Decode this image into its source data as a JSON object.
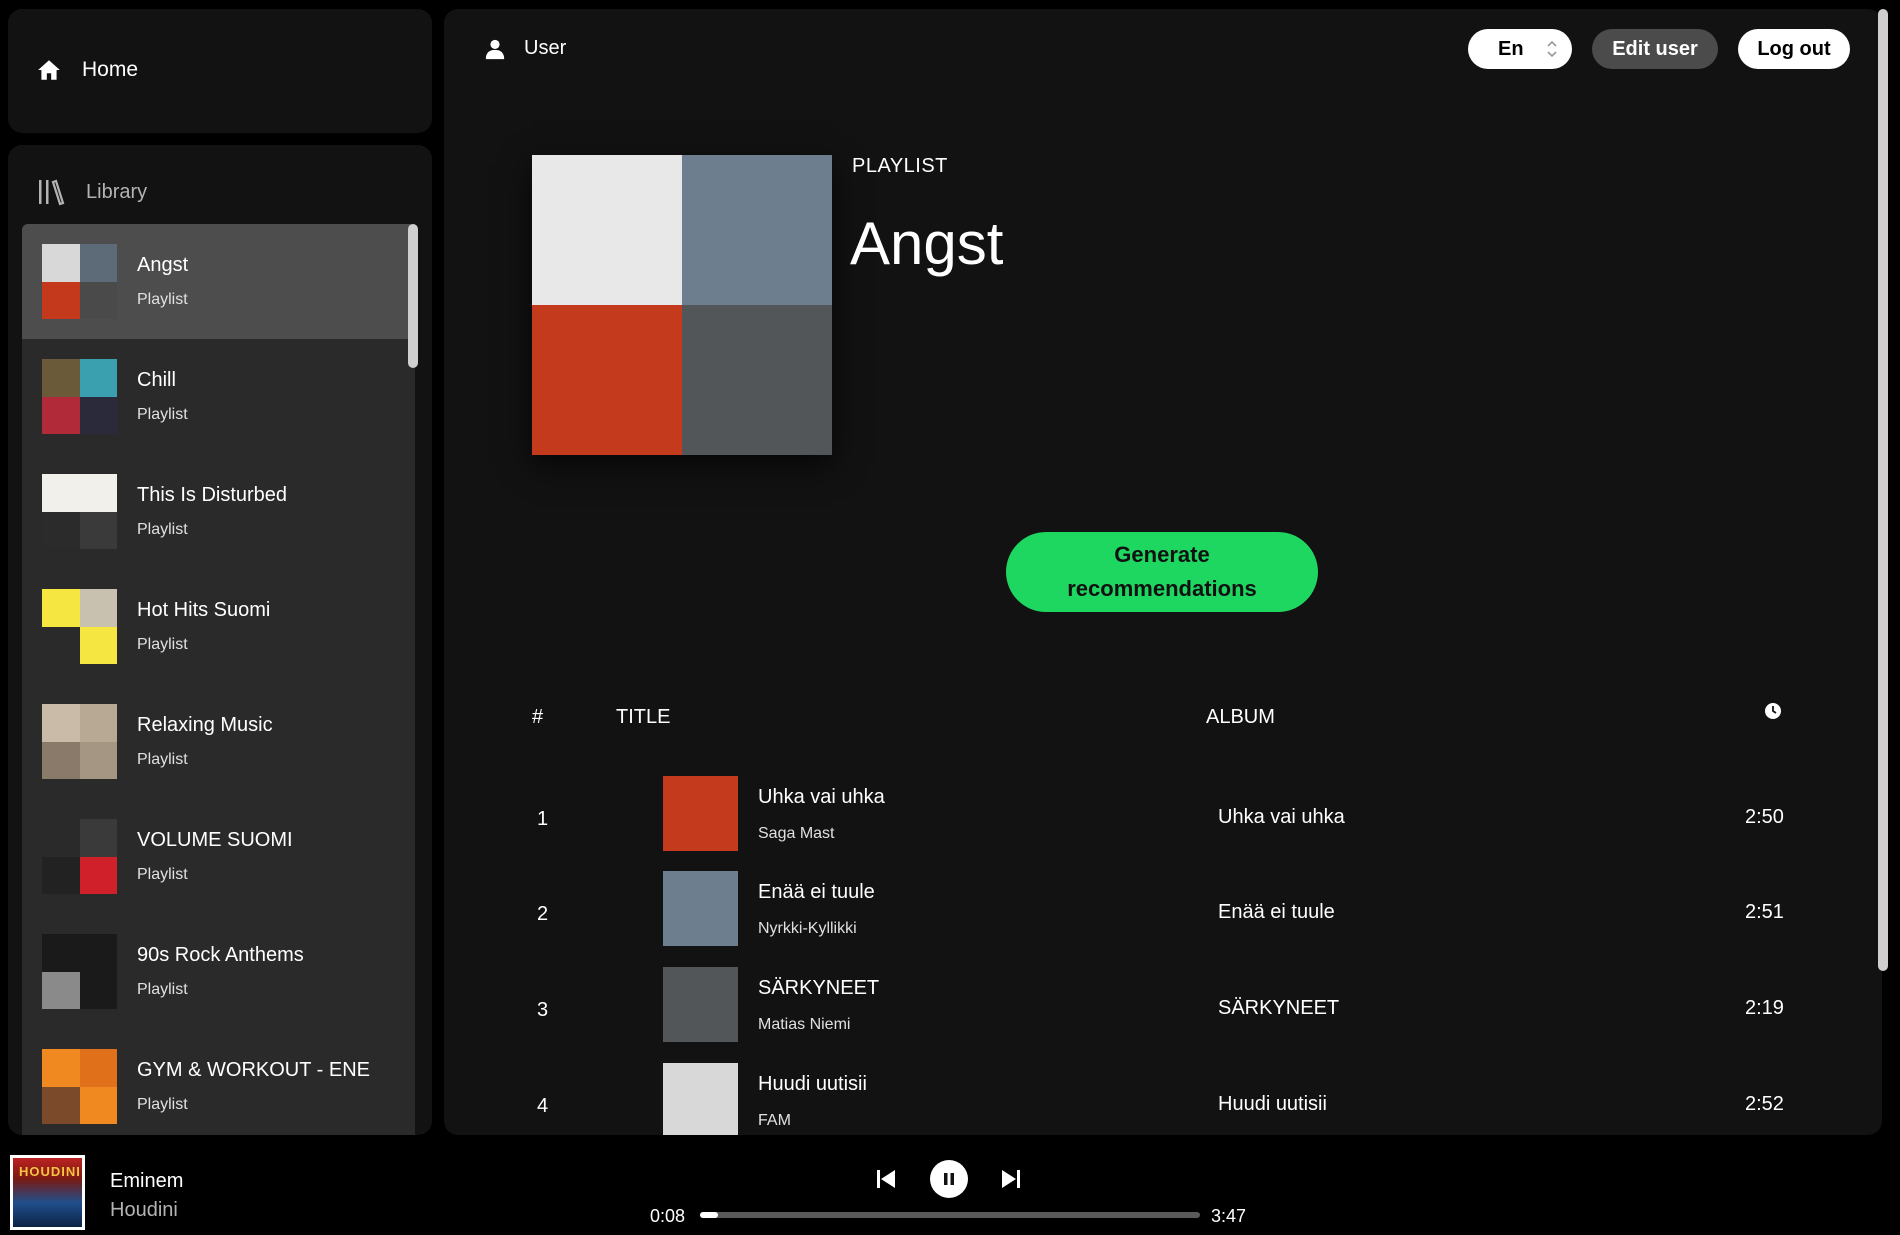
{
  "nav": {
    "home_label": "Home",
    "library_label": "Library"
  },
  "library": {
    "items": [
      {
        "title": "Angst",
        "subtitle": "Playlist",
        "colors": [
          "#d8d8d8",
          "#5d6b78",
          "#c4391b",
          "#4a4a4a"
        ]
      },
      {
        "title": "Chill",
        "subtitle": "Playlist",
        "colors": [
          "#6a5a3a",
          "#3aa0b0",
          "#b02a3a",
          "#2a2a3a"
        ]
      },
      {
        "title": "This Is Disturbed",
        "subtitle": "Playlist",
        "colors": [
          "#f2f0ea",
          "#f2f0ea",
          "#2b2b2b",
          "#3a3a3a"
        ]
      },
      {
        "title": "Hot Hits Suomi",
        "subtitle": "Playlist",
        "colors": [
          "#f5e642",
          "#c9c1b0",
          "#2a2a2a",
          "#f5e642"
        ]
      },
      {
        "title": "Relaxing Music",
        "subtitle": "Playlist",
        "colors": [
          "#c9bba8",
          "#b8a994",
          "#8a7a6a",
          "#a59683"
        ]
      },
      {
        "title": "VOLUME SUOMI",
        "subtitle": "Playlist",
        "colors": [
          "#2a2a2a",
          "#3a3a3a",
          "#222222",
          "#d0202a"
        ]
      },
      {
        "title": "90s Rock Anthems",
        "subtitle": "Playlist",
        "colors": [
          "#1a1a1a",
          "#1a1a1a",
          "#8a8a8a",
          "#1a1a1a"
        ]
      },
      {
        "title": "GYM & WORKOUT - ENE",
        "subtitle": "Playlist",
        "colors": [
          "#f08a20",
          "#e0701a",
          "#7a4a2a",
          "#f08a20"
        ]
      }
    ]
  },
  "header": {
    "user_label": "User",
    "language": "En",
    "edit_user_label": "Edit user",
    "logout_label": "Log out"
  },
  "playlist": {
    "type_label": "PLAYLIST",
    "name": "Angst",
    "cover_colors": [
      "#e8e8e8",
      "#6d7e8e",
      "#c43a1c",
      "#525658"
    ],
    "generate_line1": "Generate",
    "generate_line2": "recommendations"
  },
  "table": {
    "headers": {
      "num": "#",
      "title": "TITLE",
      "album": "ALBUM"
    },
    "tracks": [
      {
        "num": "1",
        "title": "Uhka vai uhka",
        "artist": "Saga Mast",
        "album": "Uhka vai uhka",
        "duration": "2:50",
        "color": "#c43a1c"
      },
      {
        "num": "2",
        "title": "Enää ei tuule",
        "artist": "Nyrkki-Kyllikki",
        "album": "Enää ei tuule",
        "duration": "2:51",
        "color": "#6d7e8e"
      },
      {
        "num": "3",
        "title": "SÄRKYNEET",
        "artist": "Matias Niemi",
        "album": "SÄRKYNEET",
        "duration": "2:19",
        "color": "#525658"
      },
      {
        "num": "4",
        "title": "Huudi uutisii",
        "artist": "FAM",
        "album": "Huudi uutisii",
        "duration": "2:52",
        "color": "#d8d8d8"
      }
    ]
  },
  "player": {
    "artist": "Eminem",
    "song": "Houdini",
    "cover_text": "HOUDINI",
    "current_time": "0:08",
    "total_time": "3:47",
    "progress_fraction": 0.035
  }
}
